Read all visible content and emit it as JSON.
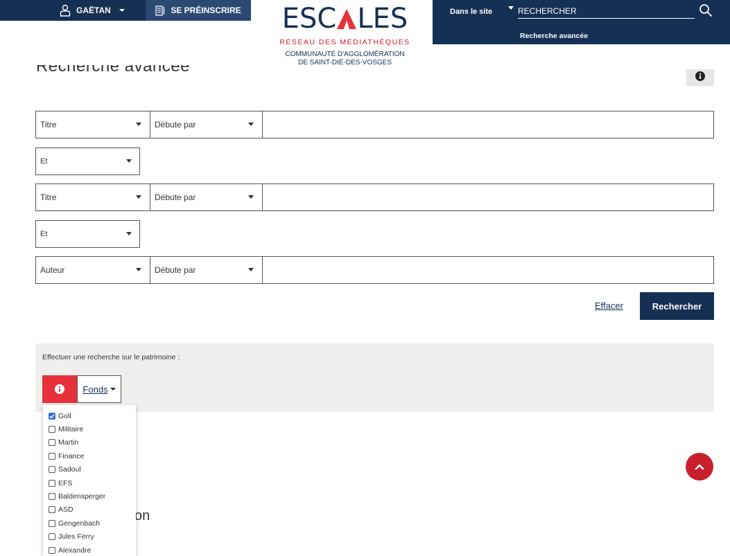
{
  "header": {
    "user_label": "GAËTAN",
    "preregister_label": "SE PRÉINSCRIRE"
  },
  "logo": {
    "main_left": "ESC",
    "main_right": "LES",
    "network": "RÉSEAU DES MÉDIATHÈQUES",
    "community_line1": "COMMUNAUTÉ D'AGGLOMÉRATION",
    "community_line2": "DE SAINT-DIÉ-DES-VOSGES"
  },
  "search": {
    "scope": "Dans le site",
    "placeholder": "RECHERCHER",
    "advanced_link": "Recherche avancée"
  },
  "page": {
    "title": "Recherche avancée"
  },
  "criteria": [
    {
      "field": "Titre",
      "operator": "Débute par",
      "value": ""
    },
    {
      "field": "Titre",
      "operator": "Débute par",
      "value": ""
    },
    {
      "field": "Auteur",
      "operator": "Débute par",
      "value": ""
    }
  ],
  "booleans": [
    "Et",
    "Et"
  ],
  "actions": {
    "clear_label": "Effacer",
    "submit_label": "Rechercher"
  },
  "heritage": {
    "label": "Effectuer une recherche sur le patrimoine :",
    "fonds_label": "Fonds",
    "items": [
      {
        "label": "Goll",
        "checked": true
      },
      {
        "label": "Militaire",
        "checked": false
      },
      {
        "label": "Martin",
        "checked": false
      },
      {
        "label": "Finance",
        "checked": false
      },
      {
        "label": "Sadoul",
        "checked": false
      },
      {
        "label": "EFS",
        "checked": false
      },
      {
        "label": "Baldensperger",
        "checked": false
      },
      {
        "label": "ASD",
        "checked": false
      },
      {
        "label": "Gengenbach",
        "checked": false
      },
      {
        "label": "Jules Ferry",
        "checked": false
      },
      {
        "label": "Alexandre",
        "checked": false
      }
    ]
  },
  "partial_heading": "on",
  "colors": {
    "navy": "#153055",
    "accent_red": "#e8303a",
    "dark_red": "#c8202c"
  }
}
